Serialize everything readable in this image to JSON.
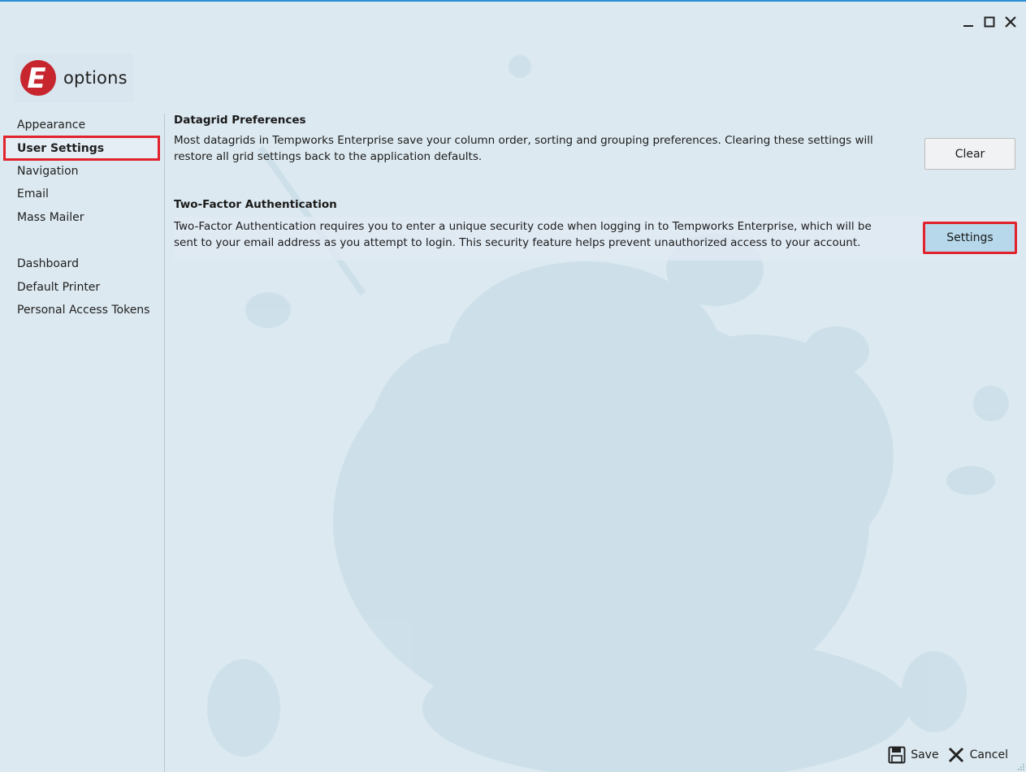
{
  "window": {
    "controls": [
      {
        "icon": "minimize-icon"
      },
      {
        "icon": "maximize-icon"
      },
      {
        "icon": "close-icon"
      }
    ]
  },
  "logo": {
    "letter": "E",
    "text": "options",
    "brand_color": "#c8262f"
  },
  "sidebar": {
    "items": [
      {
        "label": "Appearance",
        "selected": false
      },
      {
        "label": "User Settings",
        "selected": true
      },
      {
        "label": "Navigation",
        "selected": false
      },
      {
        "label": "Email",
        "selected": false
      },
      {
        "label": "Mass Mailer",
        "selected": false
      },
      {
        "label": "Dashboard",
        "selected": false
      },
      {
        "label": "Default Printer",
        "selected": false
      },
      {
        "label": "Personal Access Tokens",
        "selected": false
      }
    ]
  },
  "datagrid": {
    "title": "Datagrid Preferences",
    "text": "Most datagrids in Tempworks Enterprise save your column order, sorting and grouping preferences.  Clearing these settings will restore all grid settings back to the application defaults.",
    "button_label": "Clear"
  },
  "two_factor": {
    "title": "Two-Factor Authentication",
    "text": "Two-Factor Authentication requires you to enter a unique security code when logging in to Tempworks Enterprise, which will be sent to your email address as you attempt to login. This security feature helps prevent unauthorized access to your account.",
    "button_label": "Settings"
  },
  "footer": {
    "save_label": "Save",
    "cancel_label": "Cancel"
  },
  "colors": {
    "accent_border": "#2b8fd6",
    "highlight_red": "#e2222d",
    "background": "#dce9f0"
  }
}
